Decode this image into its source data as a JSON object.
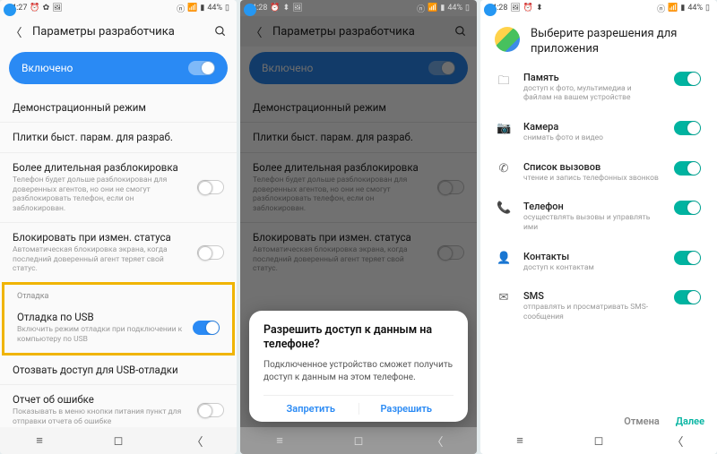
{
  "status": {
    "time1": "14:27",
    "time2": "14:28",
    "time3": "14:28",
    "battery": "44%"
  },
  "appbar": {
    "title": "Параметры разработчика"
  },
  "master": {
    "label": "Включено"
  },
  "dev_items": {
    "demo": "Демонстрационный режим",
    "tiles": "Плитки быст. парам. для разраб.",
    "unlock_label": "Более длительная разблокировка",
    "unlock_desc": "Телефон будет дольше разблокирован для доверенных агентов, но они не смогут разблокировать телефон, если он заблокирован.",
    "block_label": "Блокировать при измен. статуса",
    "block_desc": "Автоматическая блокировка экрана, когда последний доверенный агент теряет свой статус.",
    "debug_section": "Отладка",
    "usb_label": "Отладка по USB",
    "usb_desc": "Включить режим отладки при подключении к компьютеру по USB",
    "revoke": "Отозвать доступ для USB-отладки",
    "report_label": "Отчет об ошибке",
    "report_desc": "Показывать в меню кнопки питания пункт для отправки отчета об ошибке"
  },
  "dialog": {
    "title": "Разрешить доступ к данным на телефоне?",
    "body": "Подключенное устройство сможет получить доступ к данным на этом телефоне.",
    "deny": "Запретить",
    "allow": "Разрешить"
  },
  "perms": {
    "title": "Выберите разрешения для приложения",
    "items": [
      {
        "icon": "folder-icon",
        "glyph": "🗀",
        "label": "Память",
        "desc": "доступ к фото, мультимедиа и файлам на вашем устройстве"
      },
      {
        "icon": "camera-icon",
        "glyph": "📷",
        "label": "Камера",
        "desc": "снимать фото и видео"
      },
      {
        "icon": "call-log-icon",
        "glyph": "✆",
        "label": "Список вызовов",
        "desc": "чтение и запись телефонных звонков"
      },
      {
        "icon": "phone-icon",
        "glyph": "📞",
        "label": "Телефон",
        "desc": "осуществлять вызовы и управлять ими"
      },
      {
        "icon": "contacts-icon",
        "glyph": "👤",
        "label": "Контакты",
        "desc": "доступ к контактам"
      },
      {
        "icon": "sms-icon",
        "glyph": "✉",
        "label": "SMS",
        "desc": "отправлять и просматривать SMS-сообщения"
      }
    ],
    "cancel": "Отмена",
    "next": "Далее"
  }
}
